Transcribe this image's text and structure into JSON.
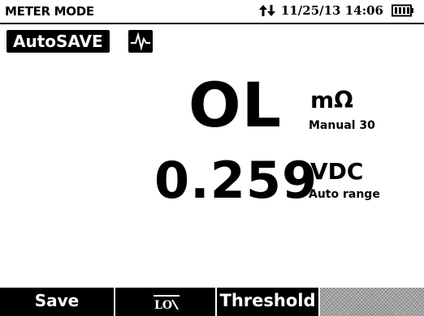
{
  "header": {
    "title": "METER MODE",
    "datetime": "11/25/13 14:06",
    "icons": [
      "transfer-arrows-icon",
      "battery-icon"
    ]
  },
  "toolbar": {
    "autosave_label": "AutoSAVE",
    "waveform_icon": "waveform-icon"
  },
  "readings": {
    "primary": {
      "value": "OL",
      "unit": "mΩ",
      "range": "Manual 30"
    },
    "secondary": {
      "value": "0.259",
      "unit": "VDC",
      "range": "Auto range"
    }
  },
  "softkeys": [
    {
      "label": "Save"
    },
    {
      "label": "",
      "icon": "lo-ohm-icon"
    },
    {
      "label": "Threshold"
    },
    {
      "label": ""
    }
  ],
  "colors": {
    "background": "#ffffff",
    "foreground": "#000000",
    "softkey_bar": "#000000",
    "inactive_softkey": "#bdbdbd"
  }
}
